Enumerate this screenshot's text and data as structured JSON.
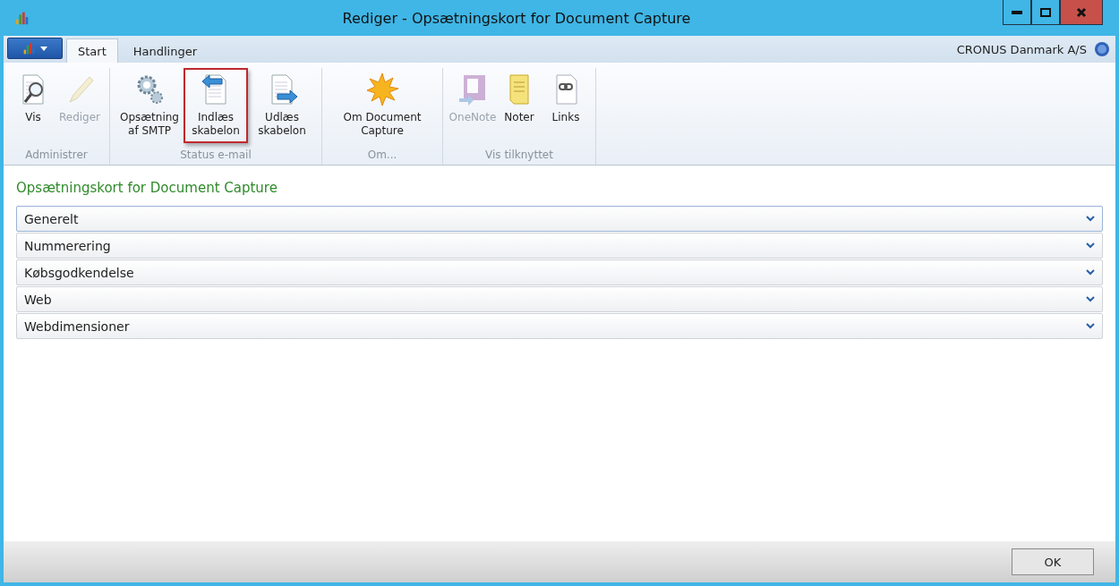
{
  "window": {
    "title": "Rediger - Opsætningskort for Document Capture"
  },
  "tabs": [
    {
      "label": "Start",
      "selected": true
    },
    {
      "label": "Handlinger",
      "selected": false
    }
  ],
  "company": "CRONUS Danmark A/S",
  "ribbon": [
    {
      "label": "Administrer",
      "buttons": [
        {
          "kind": "view",
          "label": "Vis",
          "disabled": false,
          "highlighted": false
        },
        {
          "kind": "edit",
          "label": "Rediger",
          "disabled": true,
          "highlighted": false
        }
      ]
    },
    {
      "label": "Status e-mail",
      "buttons": [
        {
          "kind": "gears",
          "label": "Opsætning af SMTP",
          "disabled": false,
          "highlighted": false
        },
        {
          "kind": "import",
          "label": "Indlæs skabelon",
          "disabled": false,
          "highlighted": true
        },
        {
          "kind": "export",
          "label": "Udlæs skabelon",
          "disabled": false,
          "highlighted": false
        }
      ]
    },
    {
      "label": "Om...",
      "buttons": [
        {
          "kind": "star",
          "label": "Om Document Capture",
          "disabled": false,
          "highlighted": false
        }
      ]
    },
    {
      "label": "Vis tilknyttet",
      "buttons": [
        {
          "kind": "onenote",
          "label": "OneNote",
          "disabled": true,
          "highlighted": false
        },
        {
          "kind": "notes",
          "label": "Noter",
          "disabled": false,
          "highlighted": false
        },
        {
          "kind": "links",
          "label": "Links",
          "disabled": false,
          "highlighted": false
        }
      ]
    }
  ],
  "page_title": "Opsætningskort for Document Capture",
  "sections": [
    {
      "label": "Generelt",
      "focused": true,
      "expanded": false
    },
    {
      "label": "Nummerering",
      "focused": false,
      "expanded": false
    },
    {
      "label": "Købsgodkendelse",
      "focused": false,
      "expanded": false
    },
    {
      "label": "Web",
      "focused": false,
      "expanded": false
    },
    {
      "label": "Webdimensioner",
      "focused": false,
      "expanded": false
    }
  ],
  "buttons": [
    "OK"
  ]
}
